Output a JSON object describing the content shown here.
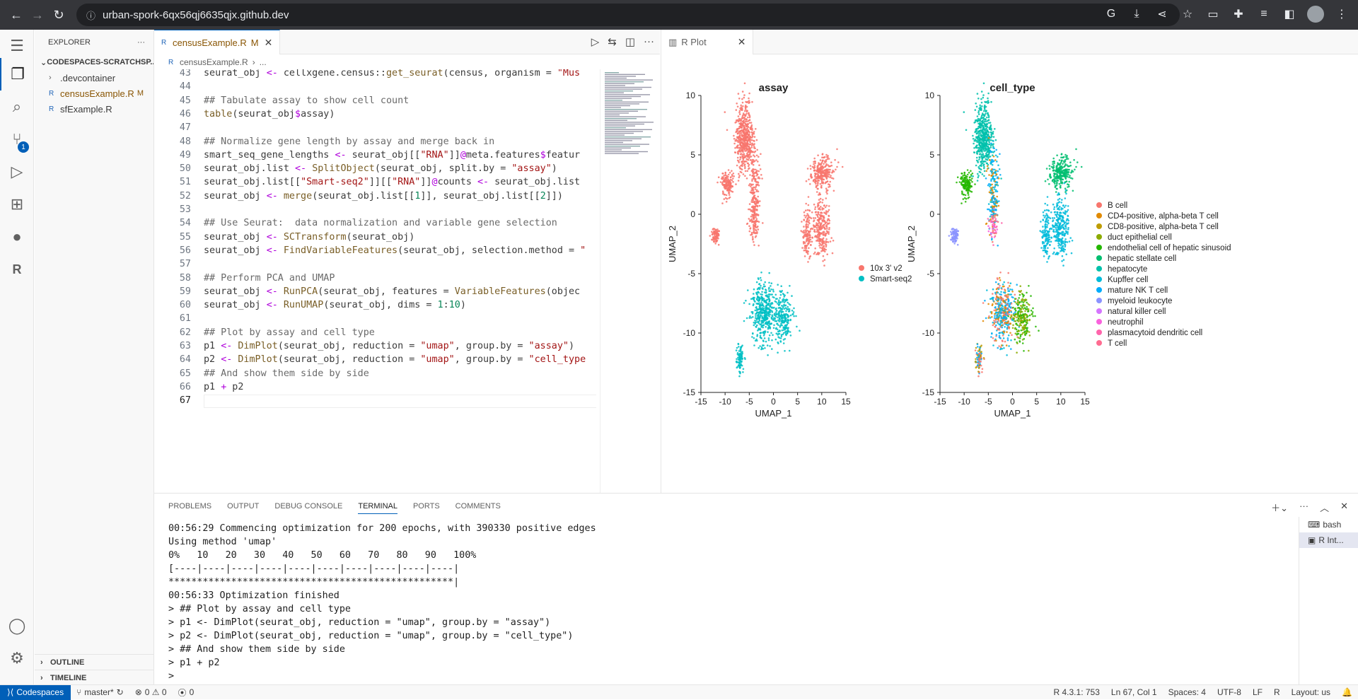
{
  "browser": {
    "url": "urban-spork-6qx56qj6635qjx.github.dev"
  },
  "activity": {
    "source_control_badge": "1"
  },
  "sidebar": {
    "title": "EXPLORER",
    "root": "CODESPACES-SCRATCHSP...",
    "items": [
      {
        "label": ".devcontainer",
        "status": ""
      },
      {
        "label": "censusExample.R",
        "status": "M"
      },
      {
        "label": "sfExample.R",
        "status": ""
      }
    ],
    "outline": "OUTLINE",
    "timeline": "TIMELINE"
  },
  "editor": {
    "tab_label": "censusExample.R",
    "tab_status": "M",
    "breadcrumb_file": "censusExample.R",
    "breadcrumb_more": "...",
    "line_numbers": [
      "43",
      "44",
      "45",
      "46",
      "47",
      "48",
      "49",
      "50",
      "51",
      "52",
      "53",
      "54",
      "55",
      "56",
      "57",
      "58",
      "59",
      "60",
      "61",
      "62",
      "63",
      "64",
      "65",
      "66",
      "67"
    ]
  },
  "rplot": {
    "tab_label": "R Plot"
  },
  "chart_data": [
    {
      "type": "scatter",
      "title": "assay",
      "xlabel": "UMAP_1",
      "ylabel": "UMAP_2",
      "xlim": [
        -15,
        15
      ],
      "ylim": [
        -15,
        10
      ],
      "xticks": [
        "-15",
        "-10",
        "-5",
        "0",
        "5",
        "10",
        "15"
      ],
      "yticks": [
        "-15",
        "-10",
        "-5",
        "0",
        "5",
        "10"
      ],
      "series": [
        {
          "name": "10x 3' v2",
          "color": "#f8766d"
        },
        {
          "name": "Smart-seq2",
          "color": "#00bfc4"
        }
      ]
    },
    {
      "type": "scatter",
      "title": "cell_type",
      "xlabel": "UMAP_1",
      "ylabel": "UMAP_2",
      "xlim": [
        -15,
        15
      ],
      "ylim": [
        -15,
        10
      ],
      "xticks": [
        "-15",
        "-10",
        "-5",
        "0",
        "5",
        "10",
        "15"
      ],
      "yticks": [
        "-15",
        "-10",
        "-5",
        "0",
        "5",
        "10"
      ],
      "series": [
        {
          "name": "B cell",
          "color": "#f8766d"
        },
        {
          "name": "CD4-positive, alpha-beta T cell",
          "color": "#e18a00"
        },
        {
          "name": "CD8-positive, alpha-beta T cell",
          "color": "#be9c00"
        },
        {
          "name": "duct epithelial cell",
          "color": "#8cab00"
        },
        {
          "name": "endothelial cell of hepatic sinusoid",
          "color": "#24b700"
        },
        {
          "name": "hepatic stellate cell",
          "color": "#00be70"
        },
        {
          "name": "hepatocyte",
          "color": "#00c1ab"
        },
        {
          "name": "Kupffer cell",
          "color": "#00bbda"
        },
        {
          "name": "mature NK T cell",
          "color": "#00acfc"
        },
        {
          "name": "myeloid leukocyte",
          "color": "#8b93ff"
        },
        {
          "name": "natural killer cell",
          "color": "#d575fe"
        },
        {
          "name": "neutrophil",
          "color": "#f962dd"
        },
        {
          "name": "plasmacytoid dendritic cell",
          "color": "#ff65ac"
        },
        {
          "name": "T cell",
          "color": "#ff6c91"
        }
      ]
    }
  ],
  "panel": {
    "tabs": [
      "PROBLEMS",
      "OUTPUT",
      "DEBUG CONSOLE",
      "TERMINAL",
      "PORTS",
      "COMMENTS"
    ],
    "active_tab": "TERMINAL",
    "terminal_lines": [
      "00:56:29 Commencing optimization for 200 epochs, with 390330 positive edges",
      "Using method 'umap'",
      "0%   10   20   30   40   50   60   70   80   90   100%",
      "[----|----|----|----|----|----|----|----|----|----|",
      "**************************************************|",
      "00:56:33 Optimization finished",
      "> ## Plot by assay and cell type",
      "> p1 <- DimPlot(seurat_obj, reduction = \"umap\", group.by = \"assay\")",
      "> p2 <- DimPlot(seurat_obj, reduction = \"umap\", group.by = \"cell_type\")",
      "> ## And show them side by side",
      "> p1 + p2",
      ">"
    ],
    "terminals": [
      "bash",
      "R Int..."
    ]
  },
  "status": {
    "remote": "Codespaces",
    "branch": "master*",
    "problems": "0 ⚠ 0",
    "ports": "0",
    "r_version": "R 4.3.1: 753",
    "cursor": "Ln 67, Col 1",
    "spaces": "Spaces: 4",
    "encoding": "UTF-8",
    "eol": "LF",
    "language": "R",
    "layout": "Layout: us"
  }
}
